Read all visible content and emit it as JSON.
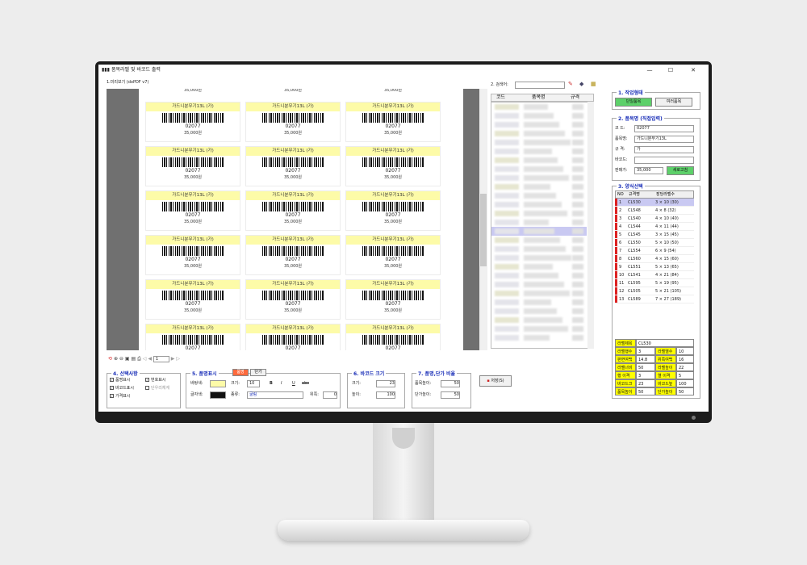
{
  "window": {
    "title": "품목라벨 및 바코드 출력",
    "minimize": "—",
    "maximize": "☐",
    "close": "✕"
  },
  "preview": {
    "label": "1.미리보기 (doPDF v7)",
    "top_partial_prices": [
      "35,000원",
      "35,000원",
      "35,000원"
    ],
    "label_name": "가드니분무기13L (가)",
    "label_code": "02077",
    "label_price": "35,000원"
  },
  "search": {
    "label": "2. 검색어:",
    "value": ""
  },
  "list": {
    "headers": [
      "코드",
      "품목명",
      "규격"
    ]
  },
  "work_type": {
    "title": "1. 작업형태",
    "single_button": "단일품목",
    "multi_button": "여러품목"
  },
  "item": {
    "title": "2. 품목명 (직접입력)",
    "code_label": "코  드:",
    "code_value": "02077",
    "name_label": "품목명:",
    "name_value": "가드니분무기13L",
    "spec_label": "규  격:",
    "spec_value": "가",
    "barcode_label": "바코드:",
    "barcode_value": "",
    "price_label": "판매가:",
    "price_value": "35,000",
    "new_button": "새로고침"
  },
  "format": {
    "title": "3. 양식선택",
    "headers": [
      "NO",
      "규격명",
      "장당라벨수"
    ],
    "rows": [
      {
        "no": "1",
        "name": "CL530",
        "count": "3 × 10 (30)"
      },
      {
        "no": "2",
        "name": "CL548",
        "count": "4 × 8 (32)"
      },
      {
        "no": "3",
        "name": "CL540",
        "count": "4 × 10 (40)"
      },
      {
        "no": "4",
        "name": "CL544",
        "count": "4 × 11 (44)"
      },
      {
        "no": "5",
        "name": "CL545",
        "count": "3 × 15 (45)"
      },
      {
        "no": "6",
        "name": "CL550",
        "count": "5 × 10 (50)"
      },
      {
        "no": "7",
        "name": "CL554",
        "count": "6 × 9 (54)"
      },
      {
        "no": "8",
        "name": "CL560",
        "count": "4 × 15 (60)"
      },
      {
        "no": "9",
        "name": "CL551",
        "count": "5 × 13 (65)"
      },
      {
        "no": "10",
        "name": "CL541",
        "count": "4 × 21 (84)"
      },
      {
        "no": "11",
        "name": "CL595",
        "count": "5 × 19 (95)"
      },
      {
        "no": "12",
        "name": "CL505",
        "count": "5 × 21 (105)"
      },
      {
        "no": "13",
        "name": "CL589",
        "count": "7 × 27 (189)"
      }
    ],
    "spec_grid": [
      [
        "라벨제목",
        "CL530",
        "",
        ""
      ],
      [
        "라벨행수",
        "3",
        "라벨열수",
        "10"
      ],
      [
        "판면여백",
        "14.8",
        "위쪽여백",
        "16"
      ],
      [
        "라벨너비",
        "50",
        "라벨높이",
        "22"
      ],
      [
        "행 이격",
        "3",
        "열 이격",
        "5"
      ],
      [
        "바코드크기",
        "23",
        "바코드높이",
        "100"
      ],
      [
        "품목높이",
        "50",
        "단가높이",
        "50"
      ]
    ]
  },
  "select": {
    "title": "4. 선택사항",
    "opt_name": "품명표시",
    "opt_barcode": "바코드표시",
    "opt_price": "가격표시",
    "opt_number": "번호표시",
    "opt_stack": "단우리체계"
  },
  "itemdisp": {
    "title": "5. 품명표시",
    "tab_item": "품명",
    "tab_price": "단가",
    "bg_label": "바탕색:",
    "size_label": "크기:",
    "size_value": "10",
    "font_color_label": "글자색:",
    "font_label": "종류:",
    "font_value": "굴림",
    "margin_label": "위쪽:",
    "margin_value": "0",
    "bold": "B",
    "italic": "I",
    "underline": "U",
    "strike": "abc"
  },
  "barcode_size": {
    "title": "6. 바코드 크기",
    "size_label": "크기:",
    "size_value": "23",
    "height_label": "높이:",
    "height_value": "100"
  },
  "ratio": {
    "title": "7. 품명,단가 비율",
    "item_label": "품목높이:",
    "item_value": "50",
    "price_label": "단가높이:",
    "price_value": "50"
  },
  "save_button": "저장(S)",
  "pager": {
    "value": "1"
  }
}
